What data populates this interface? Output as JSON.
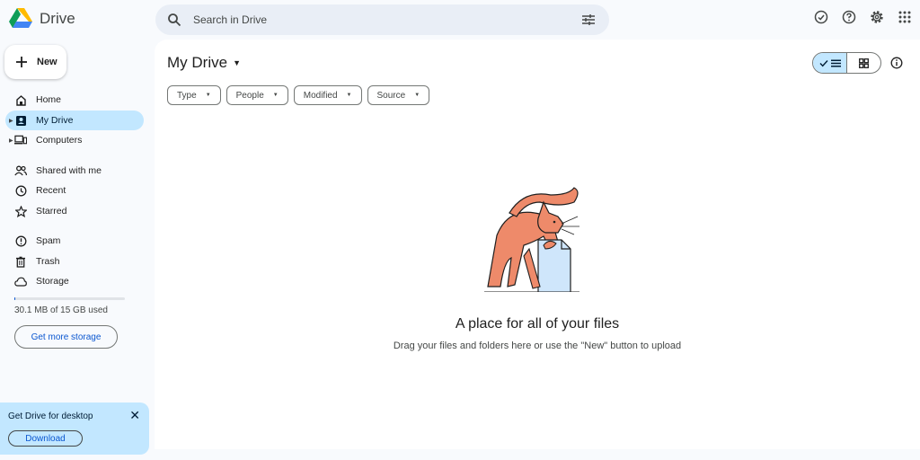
{
  "app": {
    "name": "Drive"
  },
  "search": {
    "placeholder": "Search in Drive"
  },
  "header_icons": [
    "offline-check-icon",
    "help-icon",
    "settings-icon",
    "apps-grid-icon"
  ],
  "new_button": {
    "label": "New"
  },
  "sidebar": {
    "items": [
      {
        "label": "Home",
        "icon": "home-icon"
      },
      {
        "label": "My Drive",
        "icon": "my-drive-icon",
        "active": true
      },
      {
        "label": "Computers",
        "icon": "computers-icon"
      },
      {
        "label": "Shared with me",
        "icon": "shared-icon"
      },
      {
        "label": "Recent",
        "icon": "clock-icon"
      },
      {
        "label": "Starred",
        "icon": "star-icon"
      },
      {
        "label": "Spam",
        "icon": "spam-icon"
      },
      {
        "label": "Trash",
        "icon": "trash-icon"
      },
      {
        "label": "Storage",
        "icon": "cloud-icon"
      }
    ],
    "storage_used_text": "30.1 MB of 15 GB used",
    "storage_fraction": 0.002,
    "get_storage_label": "Get more storage"
  },
  "promo": {
    "title": "Get Drive for desktop",
    "button_label": "Download"
  },
  "main": {
    "title": "My Drive",
    "filters": [
      "Type",
      "People",
      "Modified",
      "Source"
    ],
    "empty_title": "A place for all of your files",
    "empty_subtitle": "Drag your files and folders here or use the \"New\" button to upload"
  },
  "colors": {
    "accent": "#0b57d0",
    "active_bg": "#c2e7ff",
    "search_bg": "#e9eef6",
    "cat": "#ee8a6a"
  }
}
